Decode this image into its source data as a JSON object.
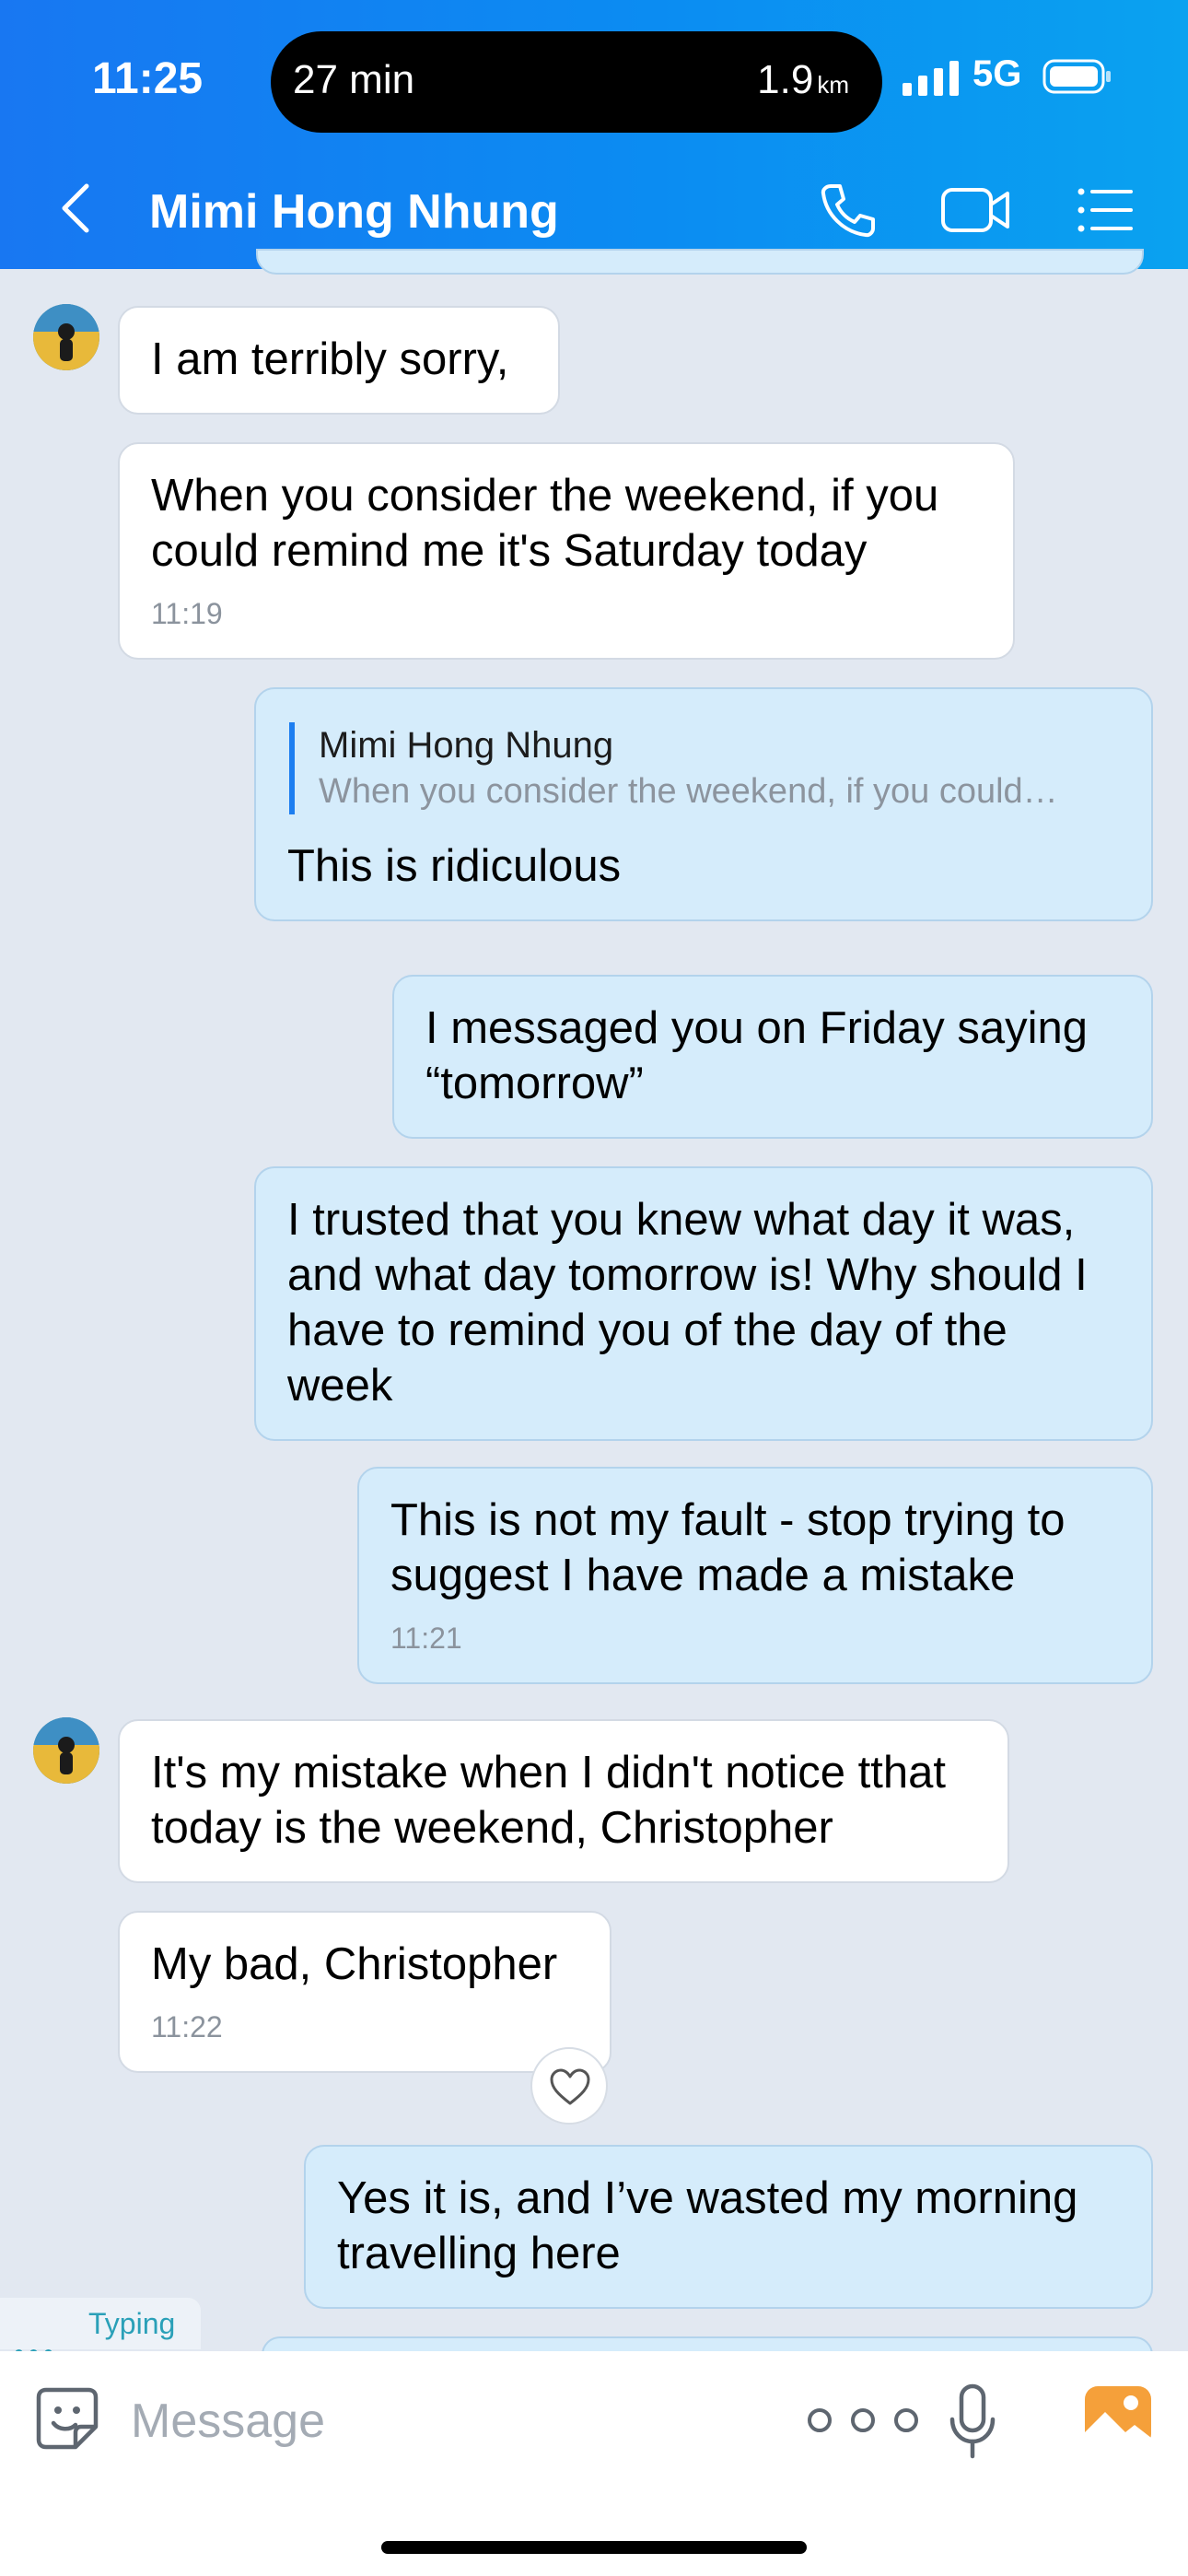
{
  "status_bar": {
    "time": "11:25",
    "island_left": "27 min",
    "island_right_value": "1.9",
    "island_right_unit": "km",
    "network": "5G"
  },
  "header": {
    "title": "Mimi Hong Nhung"
  },
  "messages": [
    {
      "direction": "in",
      "text": "I am terribly sorry,"
    },
    {
      "direction": "in",
      "text": "When you consider the weekend, if you could remind me it's Saturday today",
      "time": "11:19"
    },
    {
      "direction": "out",
      "quote_name": "Mimi Hong Nhung",
      "quote_text": "When you consider the weekend, if you could…",
      "text": "This is ridiculous"
    },
    {
      "direction": "out",
      "text": "I messaged you on Friday saying “tomorrow”"
    },
    {
      "direction": "out",
      "text": "I trusted that you knew what day it was, and what day tomorrow is! Why should I have to remind you of the day of the week"
    },
    {
      "direction": "out",
      "text": "This is not my fault - stop trying to suggest I have made a mistake",
      "time": "11:21"
    },
    {
      "direction": "in",
      "text": "It's my mistake when I didn't notice tthat today is the weekend, Christopher"
    },
    {
      "direction": "in",
      "text": "My bad, Christopher",
      "time": "11:22"
    },
    {
      "direction": "out",
      "text": "Yes it is, and I’ve wasted my morning travelling here"
    }
  ],
  "typing_indicator": "Typing",
  "composer": {
    "placeholder": "Message"
  },
  "colors": {
    "header_start": "#1877f2",
    "header_end": "#0aa2f0",
    "outgoing_bubble": "#d5ecfb",
    "incoming_bubble": "#ffffff",
    "background": "#e2e8f1",
    "photo_icon": "#f5a03a"
  },
  "icons": {
    "back": "chevron-left-icon",
    "call": "phone-icon",
    "video": "video-camera-icon",
    "menu": "list-icon",
    "emoji": "sticker-icon",
    "more": "more-dots-icon",
    "mic": "microphone-icon",
    "photo": "image-icon",
    "reaction": "heart-icon"
  }
}
